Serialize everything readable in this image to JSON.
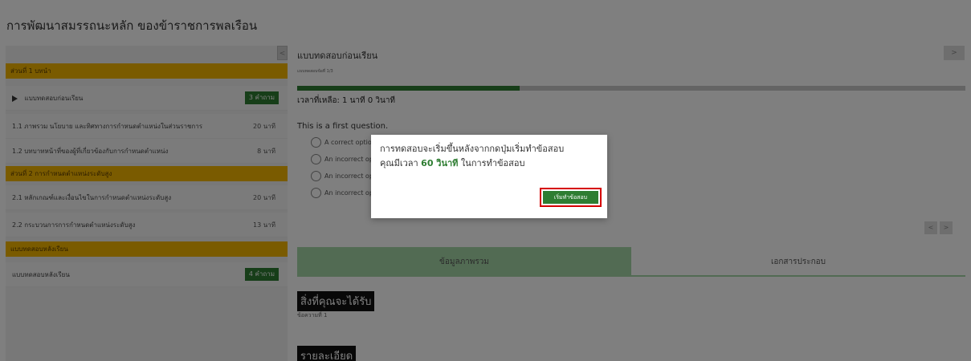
{
  "course_title": "การพัฒนาสมรรถนะหลัก ของข้าราชการพลเรือน",
  "sidebar": {
    "collapse_icon": "chevron-left",
    "sections": [
      {
        "title": "ส่วนที่ 1 บทนำ",
        "items": [
          {
            "label": "แบบทดสอบก่อนเรียน",
            "badge": "3 คำถาม",
            "icon": "play"
          },
          {
            "label": "1.1 ภาพรวม นโยบาย และทิศทางการกำหนดตำแหน่งในส่วนราชการ",
            "duration": "20 นาที"
          },
          {
            "label": "1.2 บทบาทหน้าที่ของผู้ที่เกี่ยวข้องกับการกำหนดตำแหน่ง",
            "duration": "8 นาที"
          }
        ]
      },
      {
        "title": "ส่วนที่ 2 การกำหนดตำแหน่งระดับสูง",
        "items": [
          {
            "label": "2.1 หลักเกณฑ์และเงื่อนไขในการกำหนดตำแหน่งระดับสูง",
            "duration": "20 นาที"
          },
          {
            "label": "2.2 กระบวนการการกำหนดตำแหน่งระดับสูง",
            "duration": "13 นาที"
          }
        ]
      },
      {
        "title": "แบบทดสอบหลังเรียน",
        "items": [
          {
            "label": "แบบทดสอบหลังเรียน",
            "badge": "4 คำถาม"
          }
        ]
      }
    ]
  },
  "main": {
    "header": "แบบทดสอบก่อนเรียน",
    "progress_label": "แบบทดสอบข้อที่ 1/3",
    "progress": 0.333,
    "time_left": "เวลาที่เหลือ: 1 นาที 0 วินาที",
    "question": "This is a first question.",
    "options": [
      "A correct option",
      "An incorrect option",
      "An incorrect option",
      "An incorrect option"
    ],
    "tabs": [
      "ข้อมูลภาพรวม",
      "เอกสารประกอบ"
    ],
    "section_get": "สิ่งที่คุณจะได้รับ",
    "section_get_sub": "ข้อความที่ 1",
    "section_detail": "รายละเอียด"
  },
  "modal": {
    "line1": "การทดสอบจะเริ่มขึ้นหลังจากกดปุ่มเริ่มทำข้อสอบ",
    "line2_prefix": "คุณมีเวลา ",
    "line2_highlight": "60 วินาที",
    "line2_suffix": " ในการทำข้อสอบ",
    "start_button": "เริ่มทำข้อสอบ"
  },
  "colors": {
    "accent_green": "#2e7d32",
    "section_yellow": "#f5b700",
    "tab_green": "#a5d6a7",
    "highlight_red": "#d50000"
  }
}
